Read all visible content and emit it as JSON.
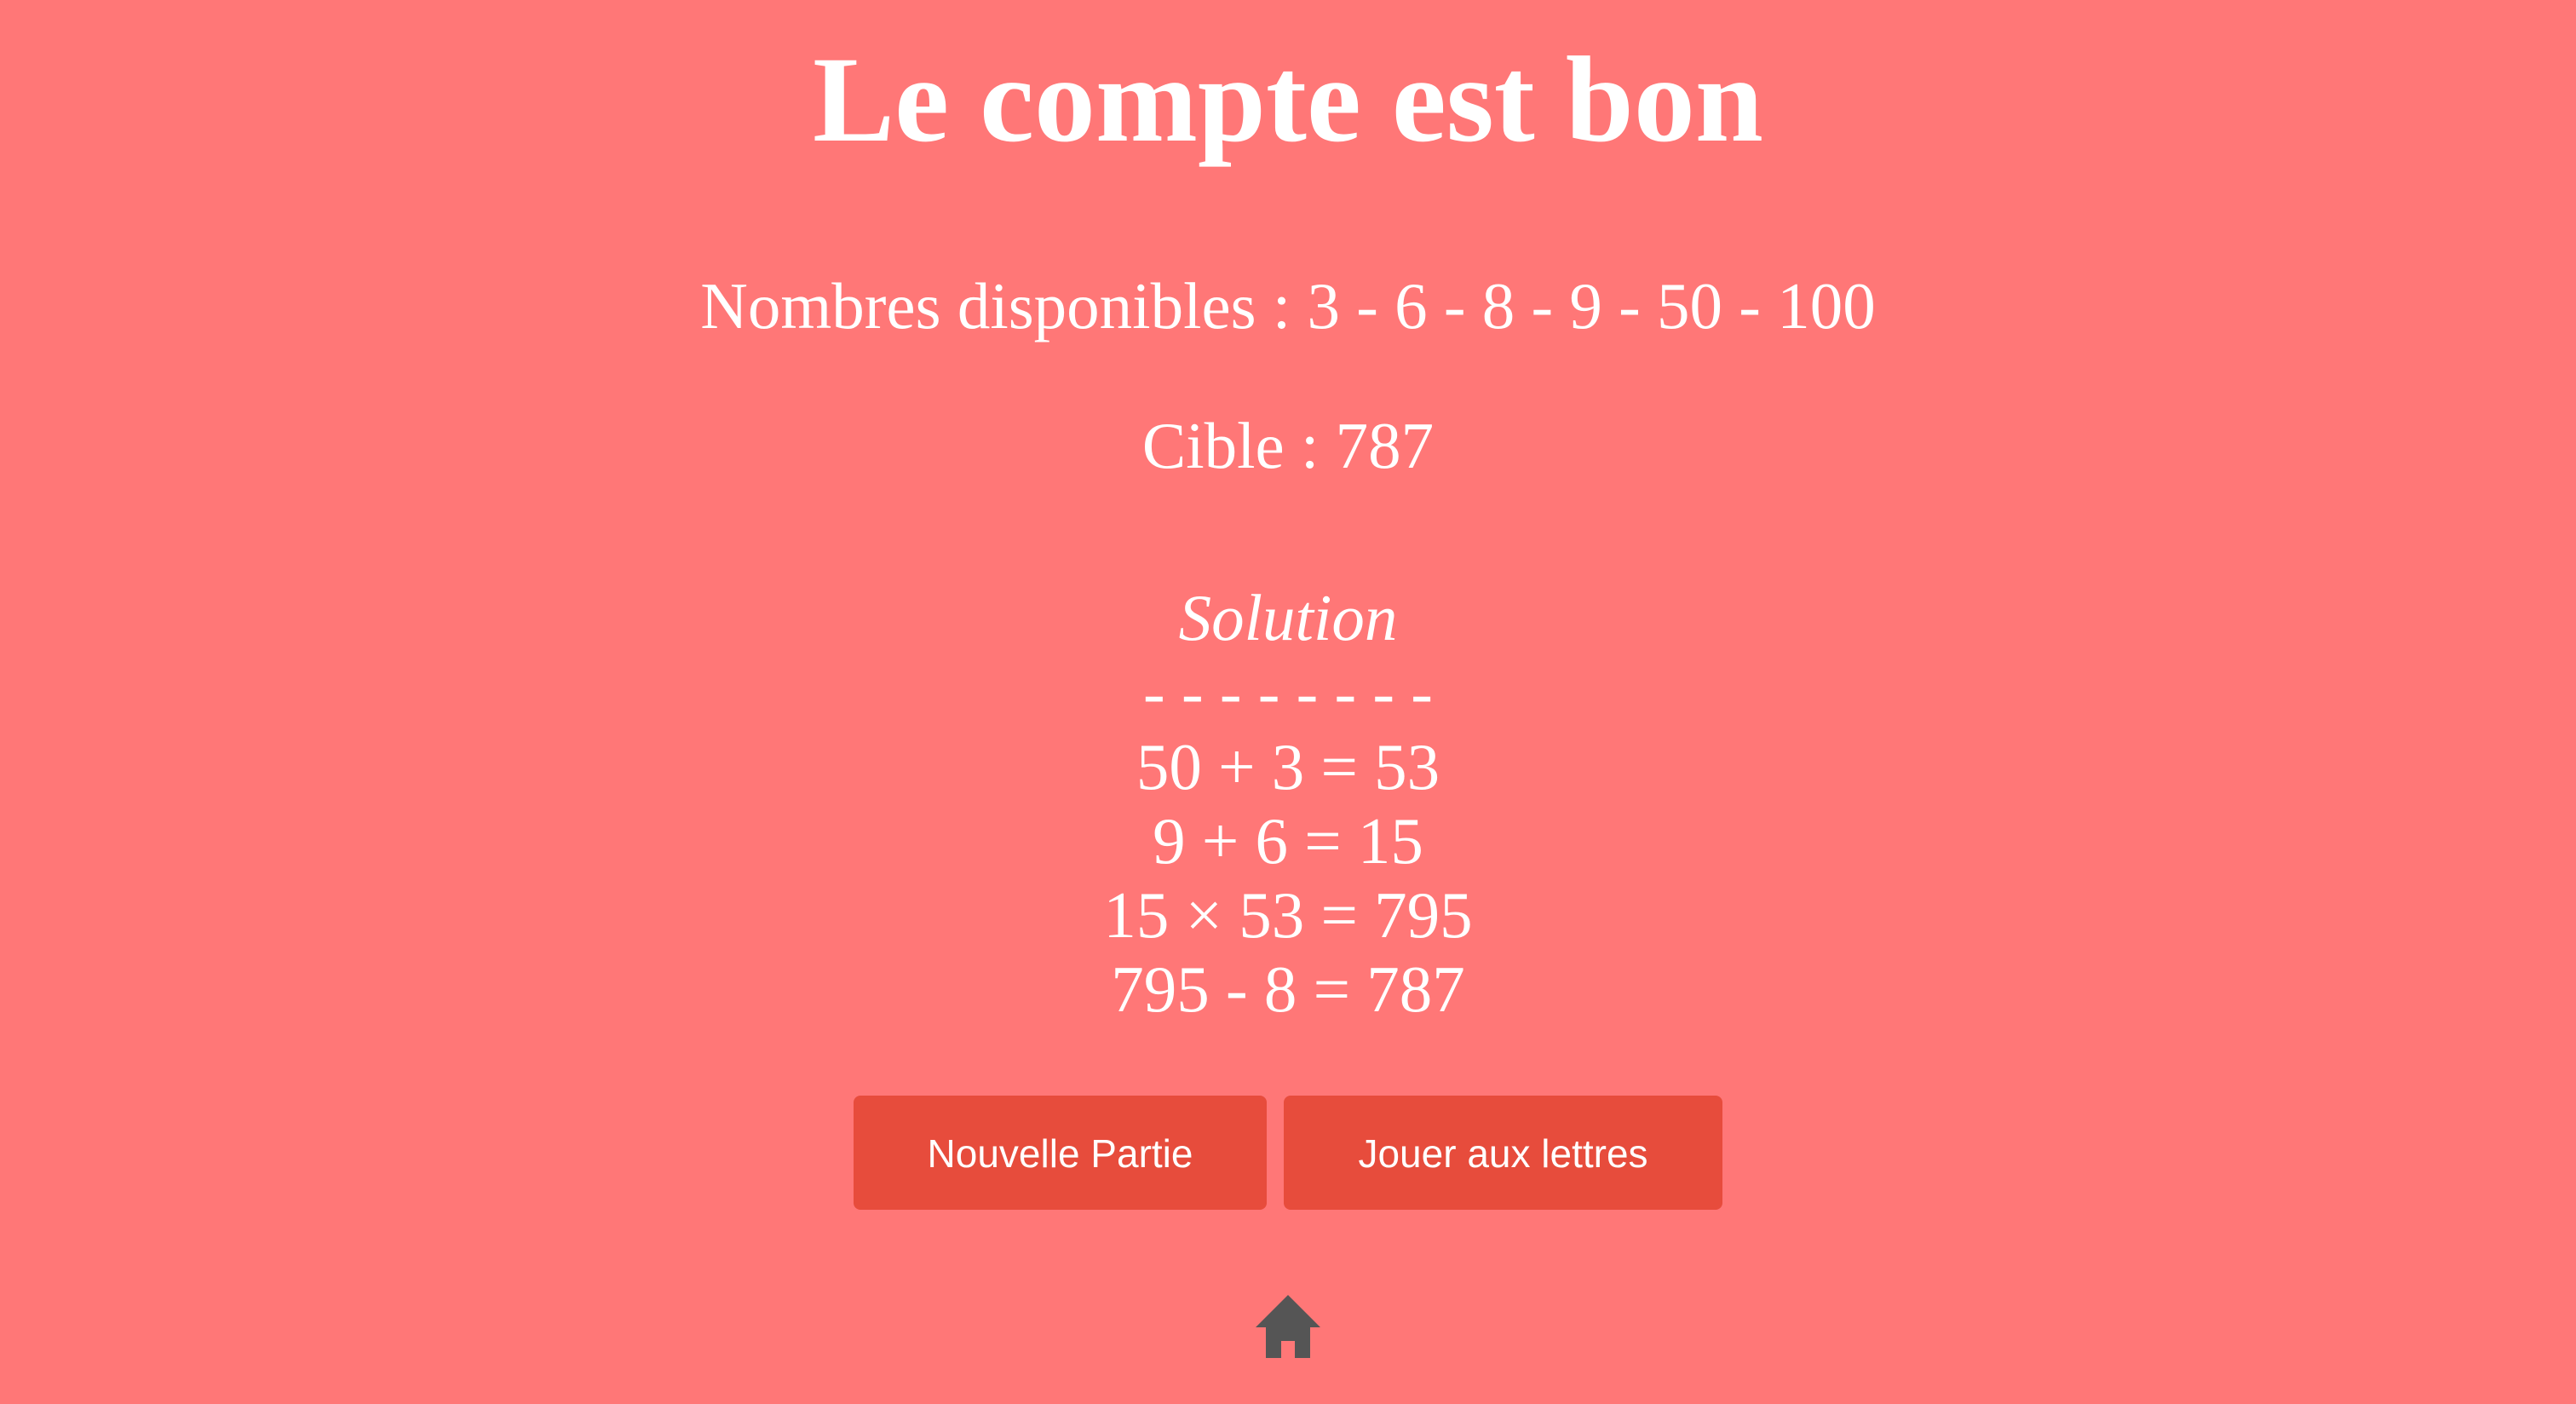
{
  "title": "Le compte est bon",
  "numbers_line": "Nombres disponibles : 3 - 6 - 8 - 9 - 50 - 100",
  "target_line": "Cible : 787",
  "solution": {
    "heading": "Solution",
    "separator": "- - - - - - - -",
    "steps": [
      "50 + 3 = 53",
      "9 + 6 = 15",
      "15 × 53 = 795",
      "795 - 8 = 787"
    ]
  },
  "buttons": {
    "new_game": "Nouvelle Partie",
    "play_letters": "Jouer aux lettres"
  },
  "icons": {
    "home": "home-icon"
  },
  "colors": {
    "background": "#ff7777",
    "button": "#e74c3c",
    "text": "#ffffff",
    "home_icon": "#555555"
  }
}
